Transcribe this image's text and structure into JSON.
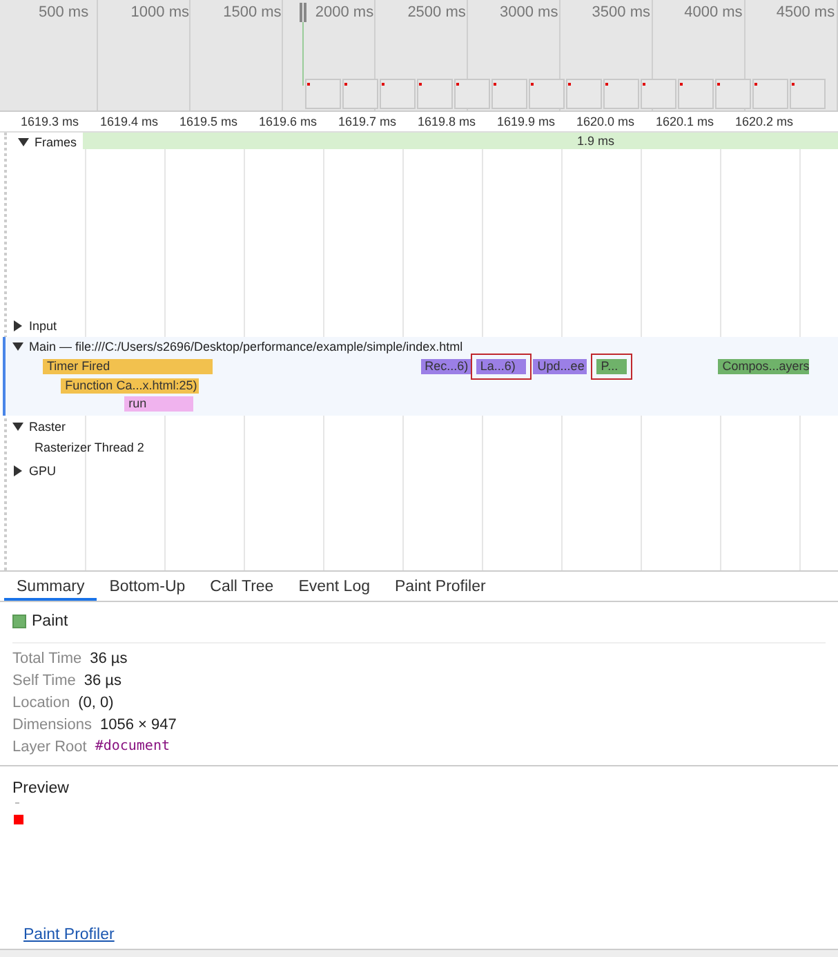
{
  "overview": {
    "ticks": [
      "500 ms",
      "1000 ms",
      "1500 ms",
      "2000 ms",
      "2500 ms",
      "3000 ms",
      "3500 ms",
      "4000 ms",
      "4500 ms"
    ]
  },
  "ruler": {
    "ticks": [
      "1619.3 ms",
      "1619.4 ms",
      "1619.5 ms",
      "1619.6 ms",
      "1619.7 ms",
      "1619.8 ms",
      "1619.9 ms",
      "1620.0 ms",
      "1620.1 ms",
      "1620.2 ms"
    ]
  },
  "tracks": [
    {
      "kind": "frames",
      "label": "Frames",
      "expanded": true,
      "frame_label": "1.9 ms"
    },
    {
      "kind": "group",
      "label": "Input",
      "expanded": false
    },
    {
      "kind": "main",
      "label": "Main — file:///C:/Users/s2696/Desktop/performance/example/simple/index.html",
      "expanded": true,
      "events": [
        {
          "label": "Timer Fired",
          "color": "#f2c14e",
          "highlighted": false,
          "children": [
            {
              "label": "Function Ca...x.html:25)",
              "color": "#f2c14e",
              "highlighted": false,
              "children": [
                {
                  "label": "run",
                  "color": "#f0b3ee",
                  "highlighted": false
                }
              ]
            }
          ]
        },
        {
          "label": "Rec...6)",
          "color": "#9b7fe6",
          "highlighted": false
        },
        {
          "label": "La...6)",
          "color": "#9b7fe6",
          "highlighted": true
        },
        {
          "label": "Upd...ee",
          "color": "#9b7fe6",
          "highlighted": false
        },
        {
          "label": "P...",
          "color": "#6fb26a",
          "highlighted": true
        },
        {
          "label": "Compos...ayers",
          "color": "#6fb26a",
          "highlighted": false
        }
      ]
    },
    {
      "kind": "group",
      "label": "Raster",
      "expanded": true,
      "children": [
        {
          "label": "Rasterizer Thread 2"
        }
      ]
    },
    {
      "kind": "group",
      "label": "GPU",
      "expanded": false
    }
  ],
  "tabs": [
    {
      "label": "Summary",
      "selected": true
    },
    {
      "label": "Bottom-Up",
      "selected": false
    },
    {
      "label": "Call Tree",
      "selected": false
    },
    {
      "label": "Event Log",
      "selected": false
    },
    {
      "label": "Paint Profiler",
      "selected": false
    }
  ],
  "summary": {
    "title": "Paint",
    "color": "#6fb26a",
    "details": [
      {
        "key": "Total Time",
        "value": "36 µs",
        "kind": "text"
      },
      {
        "key": "Self Time",
        "value": "36 µs",
        "kind": "text"
      },
      {
        "key": "Location",
        "value": "(0, 0)",
        "kind": "text"
      },
      {
        "key": "Dimensions",
        "value": "1056 × 947",
        "kind": "text"
      },
      {
        "key": "Layer Root",
        "value": "#document",
        "kind": "node"
      }
    ]
  },
  "preview": {
    "title": "Preview",
    "link": "Paint Profiler"
  }
}
